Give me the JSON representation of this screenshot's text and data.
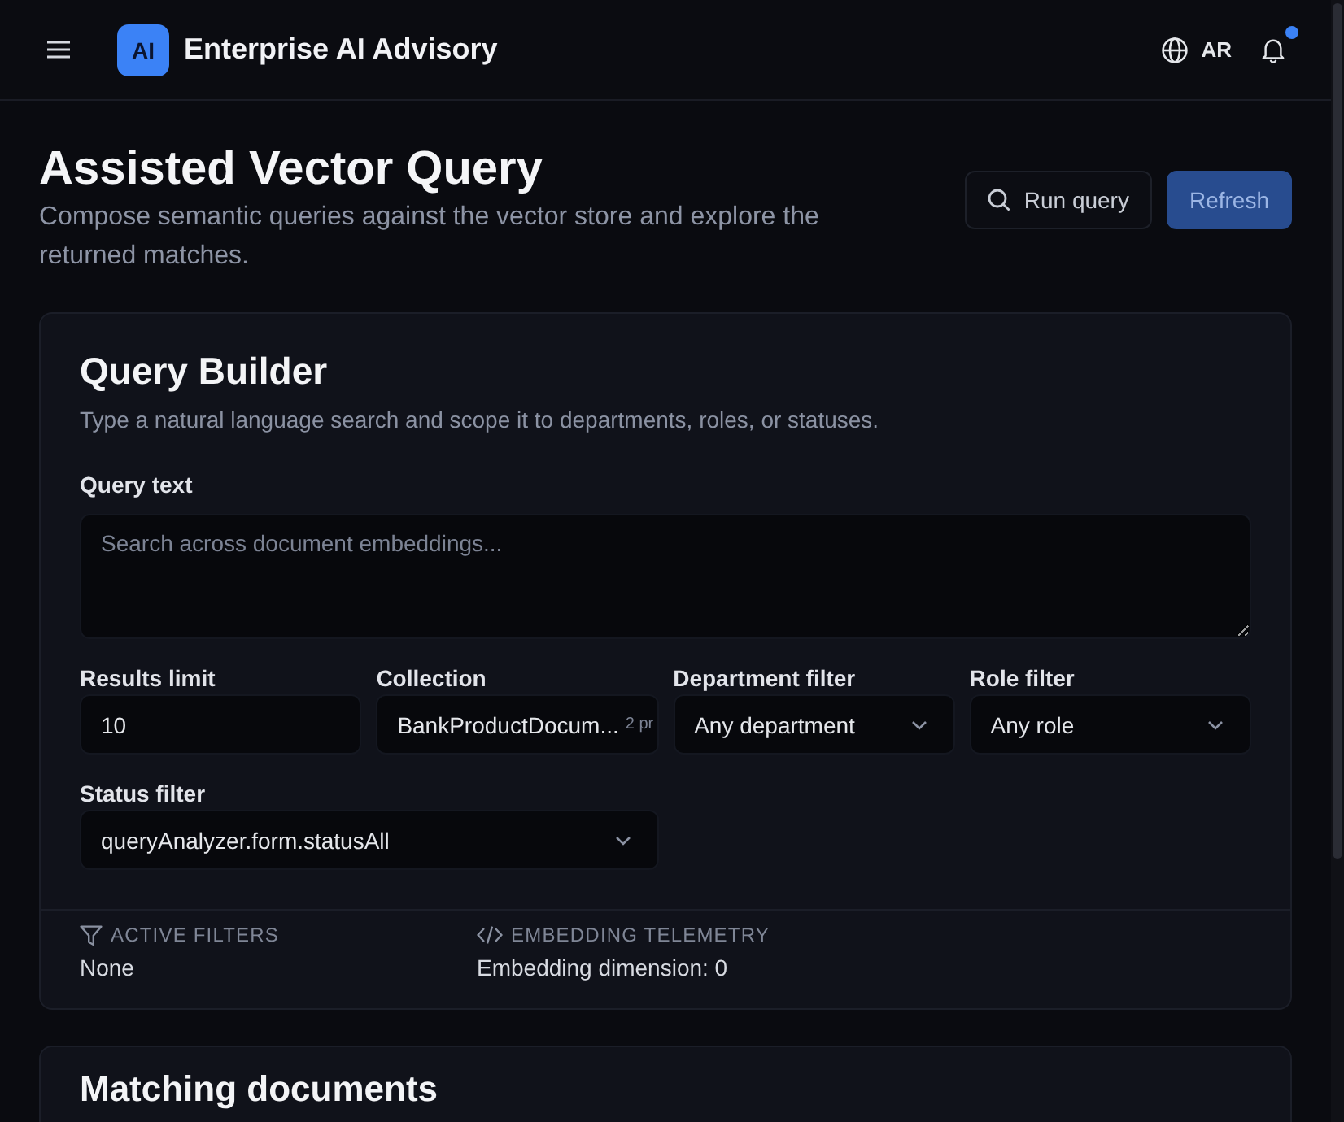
{
  "header": {
    "logo": "AI",
    "title": "Enterprise AI Advisory",
    "language": "AR",
    "notifications": {
      "unread": true
    }
  },
  "page": {
    "title": "Assisted Vector Query",
    "subtitle": "Compose semantic queries against the vector store and explore the returned matches.",
    "actions": [
      {
        "label": "Run query",
        "kind": "outline"
      },
      {
        "label": "Refresh",
        "kind": "primary"
      }
    ]
  },
  "query_builder": {
    "title": "Query Builder",
    "description": "Type a natural language search and scope it to departments, roles, or statuses.",
    "query": {
      "label": "Query text",
      "placeholder": "Search across document embeddings..."
    },
    "fields": [
      {
        "label": "Results limit",
        "kind": "input",
        "value": "10"
      },
      {
        "label": "Collection",
        "kind": "combobox",
        "value": "BankProductDocum...",
        "meta": "2 pr"
      },
      {
        "label": "Department filter",
        "kind": "select",
        "value": "Any department"
      },
      {
        "label": "Role filter",
        "kind": "select",
        "value": "Any role"
      },
      {
        "label": "Status filter",
        "kind": "select",
        "value": "queryAnalyzer.form.statusAll"
      }
    ],
    "summary": [
      {
        "kind": "filters",
        "label": "ACTIVE FILTERS",
        "value": "None"
      },
      {
        "kind": "telemetry",
        "label": "EMBEDDING TELEMETRY",
        "value": "Embedding dimension: 0"
      }
    ]
  },
  "results": {
    "title": "Matching documents"
  }
}
